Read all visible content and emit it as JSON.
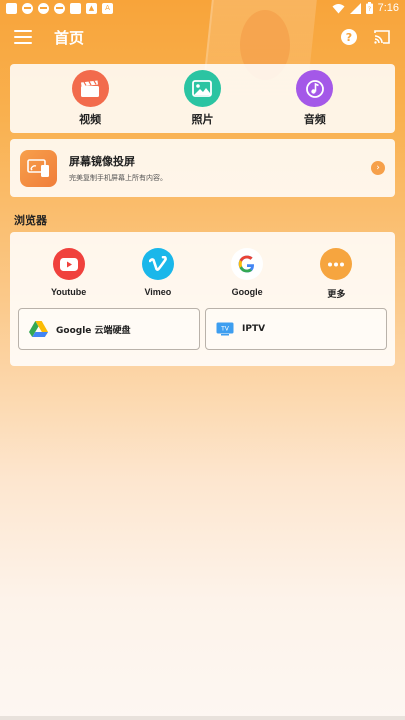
{
  "status_bar": {
    "time": "7:16",
    "left_icons": [
      "app-icon",
      "minus-circle-icon",
      "minus-circle-icon",
      "minus-circle-icon",
      "app-icon",
      "image-icon",
      "a-icon"
    ],
    "right_icons": [
      "wifi-icon",
      "signal-icon",
      "battery-icon"
    ]
  },
  "header": {
    "title": "首页",
    "help_glyph": "?"
  },
  "media": {
    "items": [
      {
        "label": "视频",
        "color": "#f26b4c",
        "icon": "video-clapper-icon"
      },
      {
        "label": "照片",
        "color": "#2bc4a2",
        "icon": "image-icon"
      },
      {
        "label": "音频",
        "color": "#a458e8",
        "icon": "music-note-icon"
      }
    ]
  },
  "mirror": {
    "title": "屏幕镜像投屏",
    "subtitle": "完美复制手机屏幕上所有内容。",
    "arrow_glyph": "›"
  },
  "browser": {
    "heading": "浏览器",
    "items": [
      {
        "label": "Youtube",
        "color": "#f0413d",
        "icon": "youtube-icon"
      },
      {
        "label": "Vimeo",
        "color": "#1ab7ea",
        "icon": "vimeo-icon"
      },
      {
        "label": "Google",
        "color": "#ffffff",
        "icon": "google-icon"
      },
      {
        "label": "更多",
        "color": "#f6a53f",
        "icon": "more-icon"
      }
    ],
    "buttons": [
      {
        "label": "Google 云端硬盘",
        "icon": "google-drive-icon"
      },
      {
        "label": "IPTV",
        "icon": "tv-icon",
        "icon_text": "TV"
      }
    ]
  },
  "colors": {
    "accent": "#f8a43a",
    "mirror_icon": "#f07d3a"
  }
}
